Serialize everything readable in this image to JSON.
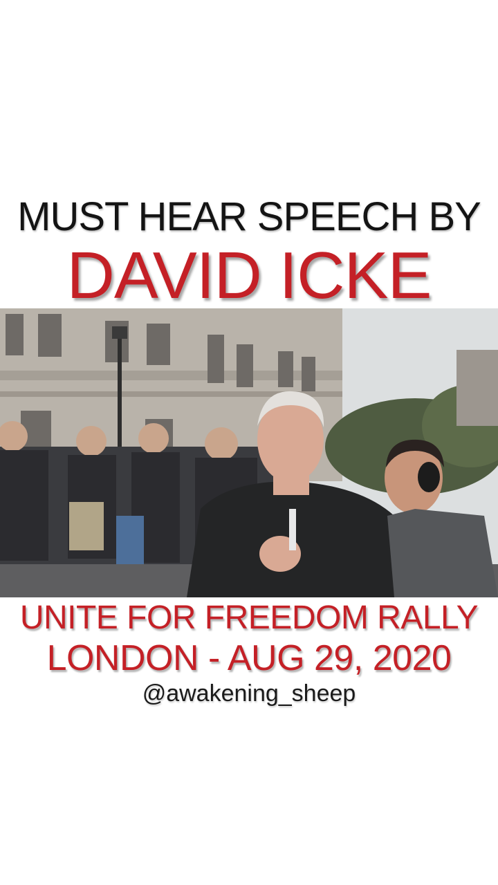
{
  "headline": {
    "line1": "MUST HEAR SPEECH BY",
    "line2": "DAVID ICKE"
  },
  "caption": {
    "line1": "UNITE FOR FREEDOM RALLY",
    "line2": "LONDON - AUG 29, 2020"
  },
  "handle": "@awakening_sheep",
  "colors": {
    "accent_red": "#c42026",
    "dark_text": "#141414",
    "background": "#ffffff"
  }
}
